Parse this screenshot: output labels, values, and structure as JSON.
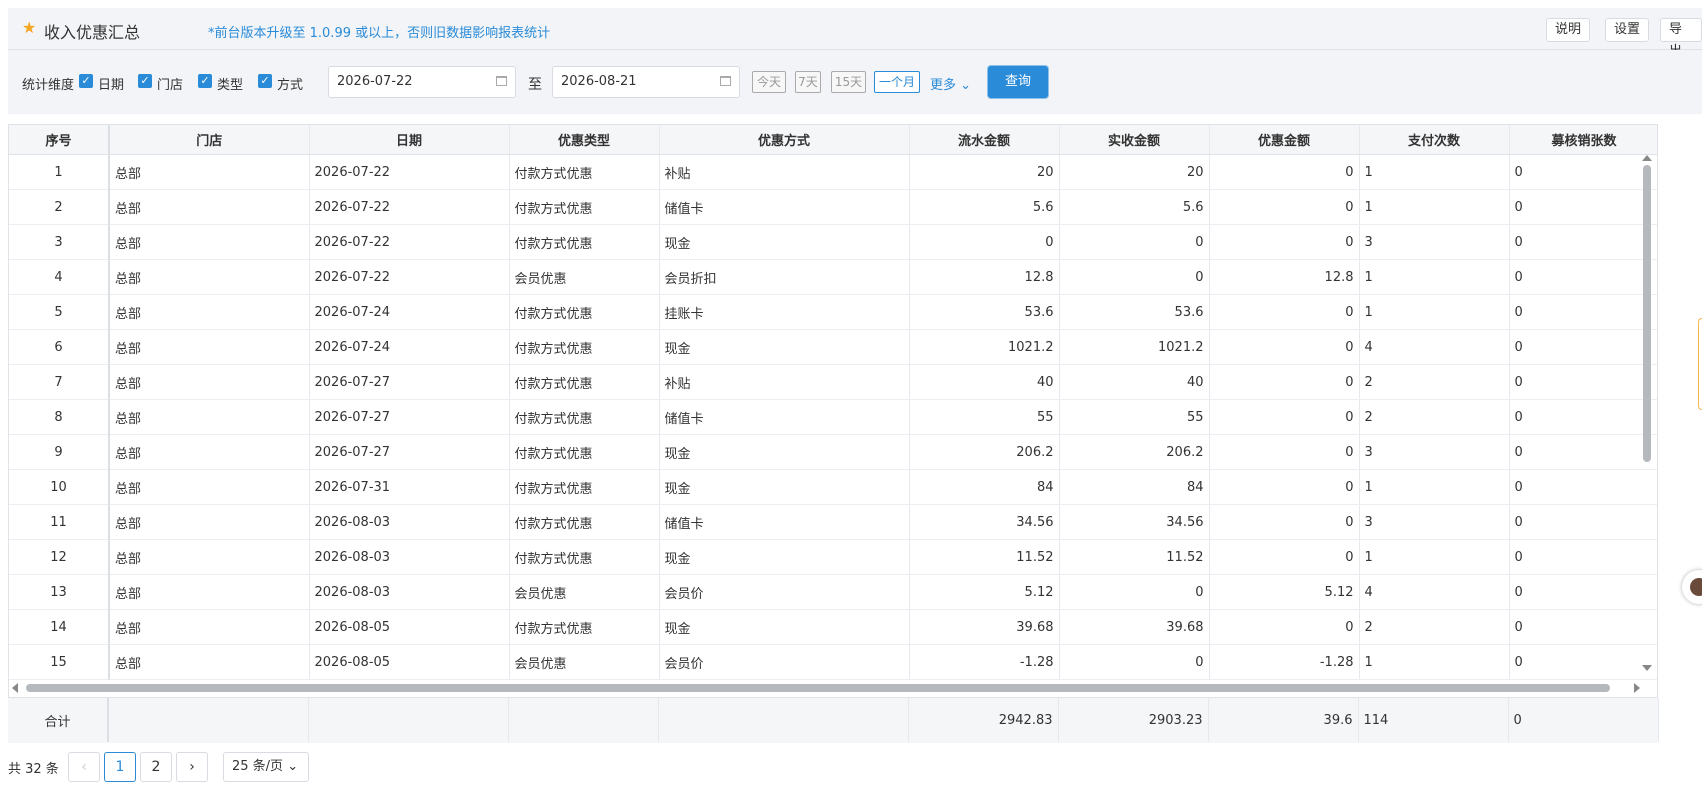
{
  "header": {
    "title": "收入优惠汇总",
    "notice": "*前台版本升级至 1.0.99 或以上，否则旧数据影响报表统计",
    "buttons": {
      "help": "说明",
      "settings": "设置",
      "export": "导出"
    }
  },
  "filters": {
    "dimension_label": "统计维度",
    "checks": [
      "日期",
      "门店",
      "类型",
      "方式"
    ],
    "start_date": "2026-07-22",
    "end_date": "2026-08-21",
    "to_label": "至",
    "quick": [
      "今天",
      "7天",
      "15天",
      "一个月"
    ],
    "more": "更多",
    "query": "查询"
  },
  "table": {
    "headers": [
      "序号",
      "门店",
      "日期",
      "优惠类型",
      "优惠方式",
      "流水金额",
      "实收金额",
      "优惠金额",
      "支付次数",
      "募核销张数"
    ],
    "rows": [
      [
        "1",
        "总部",
        "2026-07-22",
        "付款方式优惠",
        "补贴",
        "20",
        "20",
        "0",
        "1",
        "0"
      ],
      [
        "2",
        "总部",
        "2026-07-22",
        "付款方式优惠",
        "储值卡",
        "5.6",
        "5.6",
        "0",
        "1",
        "0"
      ],
      [
        "3",
        "总部",
        "2026-07-22",
        "付款方式优惠",
        "现金",
        "0",
        "0",
        "0",
        "3",
        "0"
      ],
      [
        "4",
        "总部",
        "2026-07-22",
        "会员优惠",
        "会员折扣",
        "12.8",
        "0",
        "12.8",
        "1",
        "0"
      ],
      [
        "5",
        "总部",
        "2026-07-24",
        "付款方式优惠",
        "挂账卡",
        "53.6",
        "53.6",
        "0",
        "1",
        "0"
      ],
      [
        "6",
        "总部",
        "2026-07-24",
        "付款方式优惠",
        "现金",
        "1021.2",
        "1021.2",
        "0",
        "4",
        "0"
      ],
      [
        "7",
        "总部",
        "2026-07-27",
        "付款方式优惠",
        "补贴",
        "40",
        "40",
        "0",
        "2",
        "0"
      ],
      [
        "8",
        "总部",
        "2026-07-27",
        "付款方式优惠",
        "储值卡",
        "55",
        "55",
        "0",
        "2",
        "0"
      ],
      [
        "9",
        "总部",
        "2026-07-27",
        "付款方式优惠",
        "现金",
        "206.2",
        "206.2",
        "0",
        "3",
        "0"
      ],
      [
        "10",
        "总部",
        "2026-07-31",
        "付款方式优惠",
        "现金",
        "84",
        "84",
        "0",
        "1",
        "0"
      ],
      [
        "11",
        "总部",
        "2026-08-03",
        "付款方式优惠",
        "储值卡",
        "34.56",
        "34.56",
        "0",
        "3",
        "0"
      ],
      [
        "12",
        "总部",
        "2026-08-03",
        "付款方式优惠",
        "现金",
        "11.52",
        "11.52",
        "0",
        "1",
        "0"
      ],
      [
        "13",
        "总部",
        "2026-08-03",
        "会员优惠",
        "会员价",
        "5.12",
        "0",
        "5.12",
        "4",
        "0"
      ],
      [
        "14",
        "总部",
        "2026-08-05",
        "付款方式优惠",
        "现金",
        "39.68",
        "39.68",
        "0",
        "2",
        "0"
      ],
      [
        "15",
        "总部",
        "2026-08-05",
        "会员优惠",
        "会员价",
        "-1.28",
        "0",
        "-1.28",
        "1",
        "0"
      ]
    ],
    "summary": [
      "合计",
      "",
      "",
      "",
      "",
      "2942.83",
      "2903.23",
      "39.6",
      "114",
      "0"
    ]
  },
  "pagination": {
    "total": "共 32 条",
    "pages": [
      "1",
      "2"
    ],
    "current": "1",
    "page_size": "25 条/页"
  }
}
